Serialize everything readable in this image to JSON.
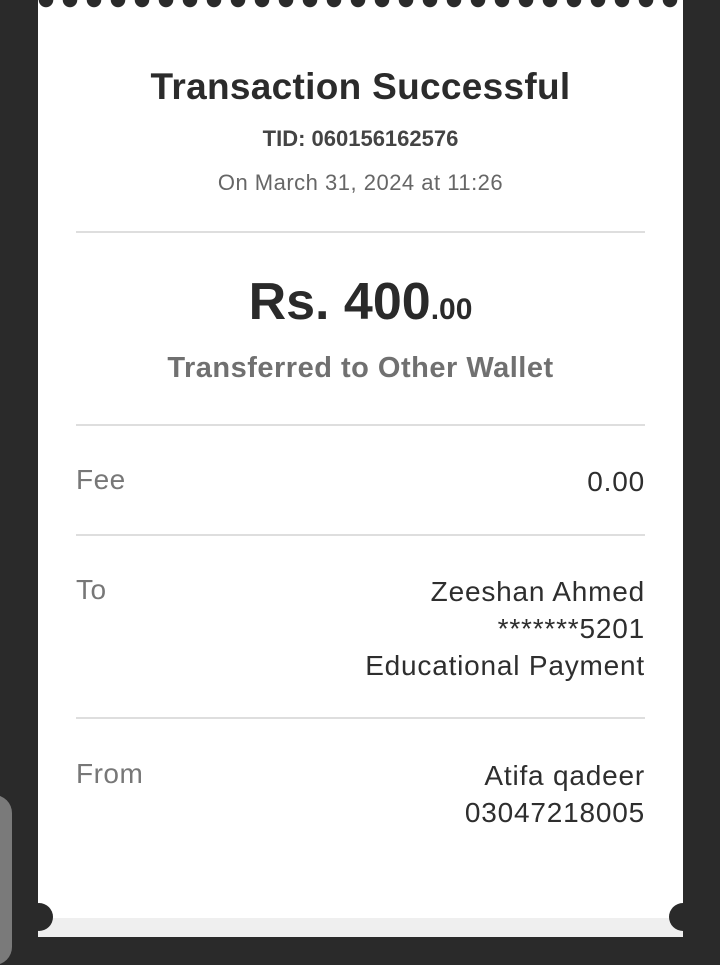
{
  "receipt": {
    "title": "Transaction Successful",
    "tid": "TID: 060156162576",
    "datetime": "On March 31, 2024 at 11:26",
    "amount_main": "Rs. 400",
    "amount_decimal": ".00",
    "transfer_type": "Transferred to Other Wallet",
    "fee": {
      "label": "Fee",
      "value": "0.00"
    },
    "to": {
      "label": "To",
      "name": "Zeeshan Ahmed",
      "account": "*******5201",
      "purpose": "Educational Payment"
    },
    "from": {
      "label": "From",
      "name": "Atifa qadeer",
      "account": "03047218005"
    }
  },
  "colors": {
    "background": "#2a2a2a",
    "card": "#ffffff",
    "divider": "#dedede",
    "muted_text": "#777777"
  }
}
